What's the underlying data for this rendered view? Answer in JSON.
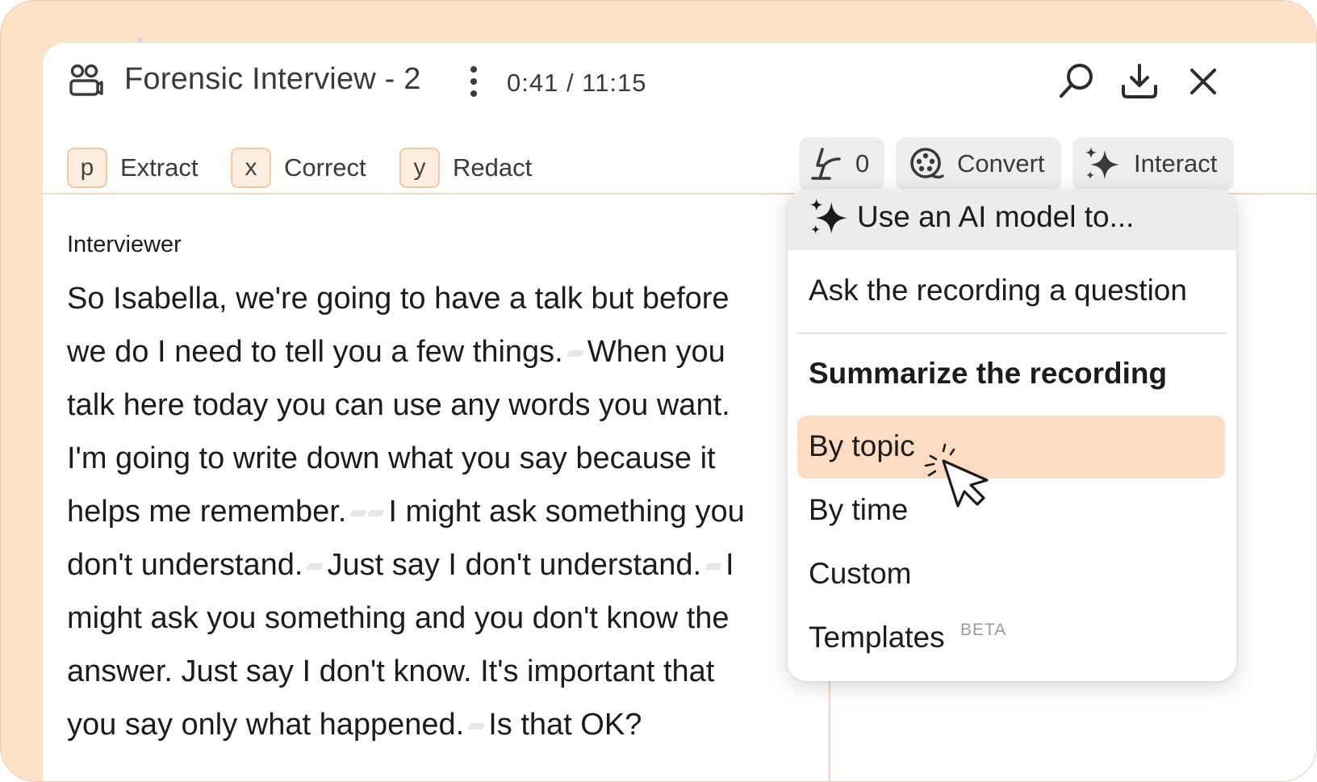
{
  "header": {
    "title": "Forensic Interview - 2",
    "time": "0:41 / 11:15",
    "icons": [
      "people-icon",
      "kebab-menu-icon",
      "search-icon",
      "download-icon",
      "close-icon"
    ]
  },
  "toolbar": {
    "extract": {
      "key": "p",
      "label": "Extract"
    },
    "correct": {
      "key": "x",
      "label": "Correct"
    },
    "redact": {
      "key": "y",
      "label": "Redact"
    },
    "highlight_count": "0",
    "convert_label": "Convert",
    "interact_label": "Interact"
  },
  "transcript": {
    "speaker": "Interviewer",
    "lines": [
      {
        "a": "So Isabella, we're going to have a talk but before",
        "b": "",
        "c": ""
      },
      {
        "a": "we do I need to tell you a few things.",
        "b": "When you",
        "c": ""
      },
      {
        "a": "talk here today you can use any words you want.",
        "b": "",
        "c": ""
      },
      {
        "a": "I'm going to write down what you say because it",
        "b": "",
        "c": ""
      },
      {
        "a": "helps me remember.",
        "b": "I might ask something you",
        "c": ""
      },
      {
        "a": "don't understand.",
        "b": "Just say I don't understand.",
        "c": "I"
      },
      {
        "a": "might ask you something and you don't know the",
        "b": "",
        "c": ""
      },
      {
        "a": "answer. Just say I don't know. It's important that",
        "b": "",
        "c": ""
      },
      {
        "a": "you say only what happened.",
        "b": "Is that OK?",
        "c": ""
      }
    ]
  },
  "menu": {
    "header": "Use an AI model to...",
    "ask": "Ask the recording a question",
    "summarize_heading": "Summarize the recording",
    "by_topic": "By topic",
    "by_time": "By time",
    "custom": "Custom",
    "templates": "Templates",
    "beta": "BETA"
  },
  "colors": {
    "frame_bg": "#fde2c8",
    "selected_item": "#fcdcc3",
    "key_border": "#f3c9a4",
    "pill_bg": "#eeeeef"
  }
}
